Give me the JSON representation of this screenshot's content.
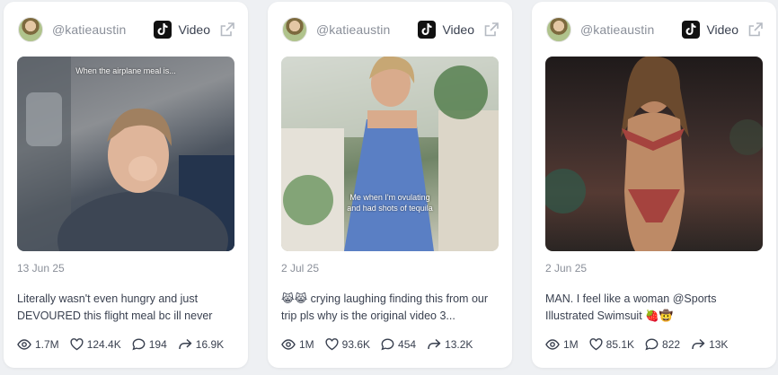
{
  "colors": {
    "background": "#eef0f3",
    "card": "#ffffff",
    "muted_text": "#8a8f99",
    "text": "#3a4150",
    "tiktok": "#111111"
  },
  "icons": [
    "tiktok-icon",
    "external-link-icon",
    "eye-icon",
    "heart-icon",
    "comment-icon",
    "share-icon"
  ],
  "cards": [
    {
      "handle": "@katieaustin",
      "platform": "Video",
      "overlay_text": "When the airplane meal is...",
      "date": "13 Jun 25",
      "description": "Literally wasn't even hungry and just DEVOURED this flight meal bc ill never sa...",
      "views": "1.7M",
      "likes": "124.4K",
      "comments": "194",
      "shares": "16.9K"
    },
    {
      "handle": "@katieaustin",
      "platform": "Video",
      "overlay_text": "Me when I'm ovulating\nand had shots of tequila",
      "date": "2 Jul 25",
      "description": "😹😹 crying laughing finding this from our trip pls why is the original video 3...",
      "views": "1M",
      "likes": "93.6K",
      "comments": "454",
      "shares": "13.2K"
    },
    {
      "handle": "@katieaustin",
      "platform": "Video",
      "overlay_text": "",
      "date": "2 Jun 25",
      "description": "MAN. I feel like a woman @Sports Illustrated Swimsuit 🍓🤠",
      "views": "1M",
      "likes": "85.1K",
      "comments": "822",
      "shares": "13K"
    }
  ]
}
